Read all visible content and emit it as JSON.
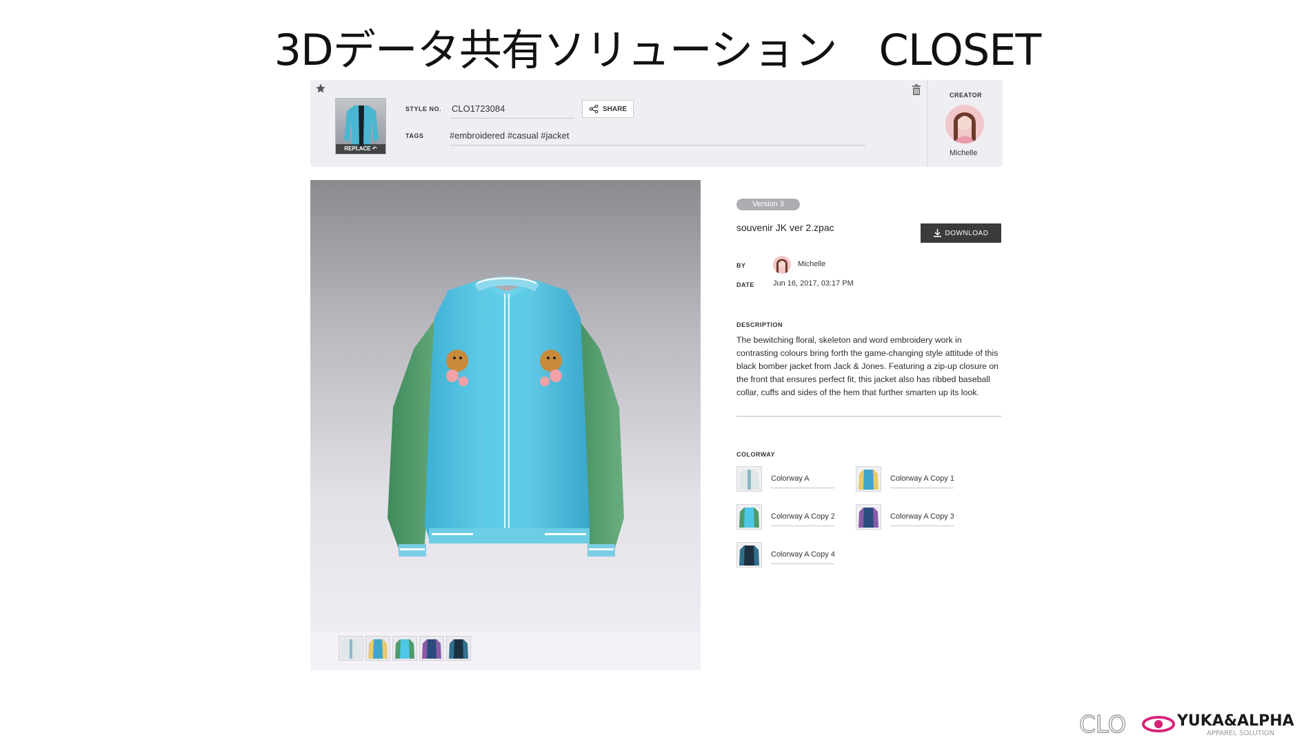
{
  "slide": {
    "title": "3Dデータ共有ソリューション　CLOSET"
  },
  "header": {
    "replace_label": "REPLACE",
    "style_no_label": "STYLE NO.",
    "style_no_value": "CLO1723084",
    "share_label": "SHARE",
    "tags_label": "TAGS",
    "tags_value": "#embroidered #casual #jacket",
    "creator_label": "CREATOR",
    "creator_name": "Michelle",
    "icons": {
      "favorite": "star-icon",
      "delete": "trash-icon",
      "share": "share-icon"
    }
  },
  "viewer": {
    "thumbnails": [
      "Colorway A",
      "Colorway A Copy 1",
      "Colorway A Copy 2",
      "Colorway A Copy 3",
      "Colorway A Copy 4"
    ]
  },
  "detail": {
    "version": "Version 3",
    "file_name": "souvenir JK ver 2.zpac",
    "download_label": "DOWNLOAD",
    "by_label": "BY",
    "by_value": "Michelle",
    "date_label": "DATE",
    "date_value": "Jun 16, 2017, 03:17 PM",
    "description_label": "DESCRIPTION",
    "description": "The bewitching floral, skeleton and word embroidery work in contrasting colours bring forth the game-changing style attitude of this black bomber jacket from Jack & Jones. Featuring a zip-up closure on the front that ensures perfect fit, this jacket also has ribbed baseball collar, cuffs and sides of the hem that further smarten up its look.",
    "colorway_label": "COLORWAY",
    "colorways": [
      "Colorway A",
      "Colorway A Copy 1",
      "Colorway A Copy 2",
      "Colorway A Copy 3",
      "Colorway A Copy 4"
    ]
  },
  "logo": {
    "left_text": "CLO",
    "brand": "YUKA&ALPHA",
    "sub": "APPAREL SOLUTION"
  },
  "colors": {
    "jacket_body": "#4fc7e6",
    "sleeve": "#4f9a6a",
    "button_dark": "#3b3b3e",
    "pill": "#adadb2"
  }
}
